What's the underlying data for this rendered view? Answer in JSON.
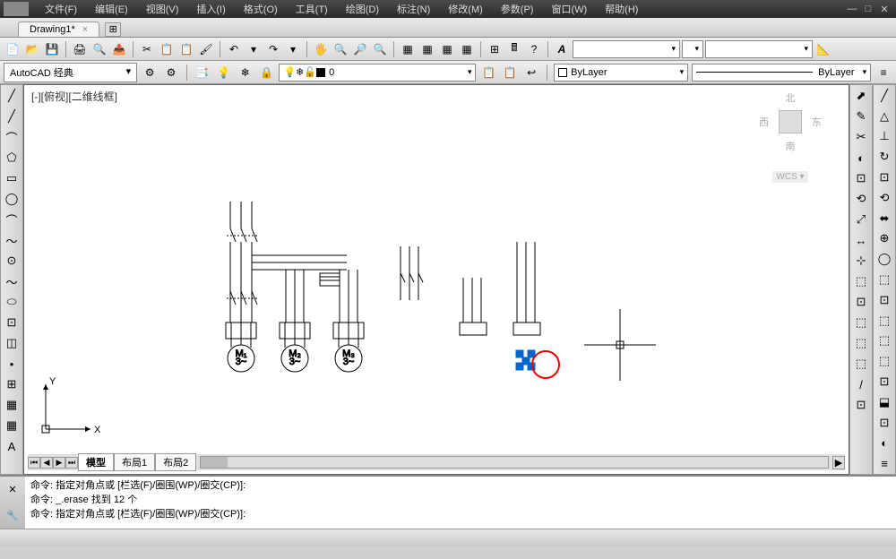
{
  "menu": {
    "items": [
      "文件(F)",
      "编辑(E)",
      "视图(V)",
      "插入(I)",
      "格式(O)",
      "工具(T)",
      "绘图(D)",
      "标注(N)",
      "修改(M)",
      "参数(P)",
      "窗口(W)",
      "帮助(H)"
    ]
  },
  "tabs": {
    "document": "Drawing1*",
    "new": "+"
  },
  "workspace": {
    "name": "AutoCAD 经典"
  },
  "layer": {
    "current": "0",
    "bylayer": "ByLayer",
    "linetype": "ByLayer"
  },
  "canvas": {
    "viewlabel": "[-][俯视][二维线框]",
    "ucs_x": "X",
    "ucs_y": "Y"
  },
  "viewcube": {
    "north": "北",
    "west": "西",
    "east": "东",
    "south": "南",
    "wcs": "WCS ▾"
  },
  "layouts": {
    "model": "模型",
    "l1": "布局1",
    "l2": "布局2"
  },
  "command": {
    "line1": "命令: 指定对角点或 [栏选(F)/圈围(WP)/圈交(CP)]:",
    "line2": "命令: _.erase 找到 12 个",
    "line3": "命令: 指定对角点或 [栏选(F)/圈围(WP)/圈交(CP)]:"
  },
  "toolbar_icons": [
    "📄",
    "📂",
    "💾",
    "",
    "🖨",
    "🔍",
    "",
    "✂",
    "📋",
    "📋",
    "🖌",
    "",
    "↶",
    "",
    "↷",
    "",
    "🖐",
    "🔍",
    "🔎",
    "🔍",
    "",
    "▦",
    "▦",
    "▦",
    "▦",
    "",
    "⊞",
    "⊞",
    "🖩",
    "📋"
  ],
  "left_icons": [
    "╱",
    "╱",
    "⌒",
    "⬠",
    "▭",
    "◯",
    "⌒",
    "～",
    "⊙",
    "～",
    "⬭",
    "⊡",
    "◫",
    "•",
    "⊞",
    "▦",
    "▦",
    "A"
  ],
  "right_icons_a": [
    "⬈",
    "✎",
    "✂",
    "◐",
    "⊡",
    "⟲",
    "⤢",
    "↔",
    "⊹",
    "⬚",
    "⊡",
    "⬚",
    "⬚",
    "⬚",
    "/",
    "⊡",
    "⊡"
  ],
  "right_icons_b": [
    "╱",
    "△",
    "⊥",
    "↻",
    "⊡",
    "⟲",
    "⬌",
    "⊕",
    "◯",
    "⬚",
    "⊡",
    "⬚",
    "⬚",
    "⬚",
    "⊡",
    "⬓",
    "⊡",
    "◐",
    "≡"
  ]
}
